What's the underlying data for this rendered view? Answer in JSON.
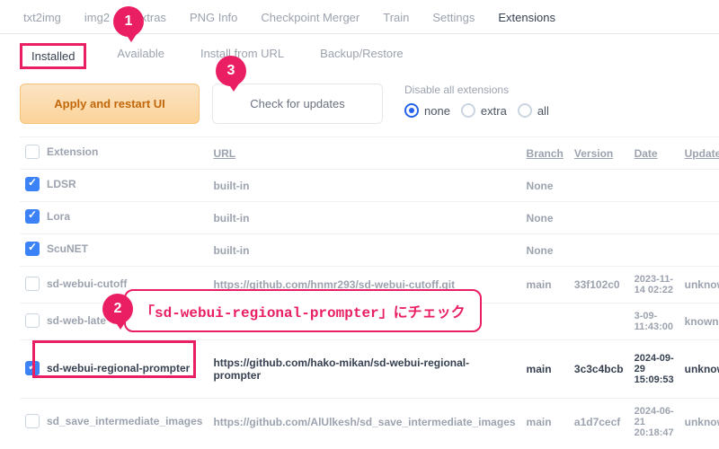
{
  "topTabs": [
    "txt2img",
    "img2",
    "Extras",
    "PNG Info",
    "Checkpoint Merger",
    "Train",
    "Settings",
    "Extensions"
  ],
  "topActive": 7,
  "subTabs": [
    "Installed",
    "Available",
    "Install from URL",
    "Backup/Restore"
  ],
  "subActive": 0,
  "buttons": {
    "apply": "Apply and restart UI",
    "check": "Check for updates"
  },
  "disable": {
    "title": "Disable all extensions",
    "options": [
      "none",
      "extra",
      "all"
    ],
    "selected": 0
  },
  "headers": {
    "ext": "Extension",
    "url": "URL",
    "branch": "Branch",
    "version": "Version",
    "date": "Date",
    "update": "Update"
  },
  "rows": [
    {
      "checked": true,
      "name": "LDSR",
      "url": "built-in",
      "branch": "None",
      "version": "",
      "date": "",
      "update": ""
    },
    {
      "checked": true,
      "name": "Lora",
      "url": "built-in",
      "branch": "None",
      "version": "",
      "date": "",
      "update": ""
    },
    {
      "checked": true,
      "name": "ScuNET",
      "url": "built-in",
      "branch": "None",
      "version": "",
      "date": "",
      "update": ""
    },
    {
      "checked": false,
      "name": "sd-webui-cutoff",
      "url": "https://github.com/hnmr293/sd-webui-cutoff.git",
      "branch": "main",
      "version": "33f102c0",
      "date": "2023-11-14 02:22",
      "update": "unknown"
    },
    {
      "checked": false,
      "name": "sd-web-late",
      "url": "",
      "branch": "",
      "version": "",
      "date": "3-09-11:43:00",
      "update": "known"
    },
    {
      "checked": true,
      "name": "sd-webui-regional-prompter",
      "url": "https://github.com/hako-mikan/sd-webui-regional-prompter",
      "branch": "main",
      "version": "3c3c4bcb",
      "date": "2024-09-29 15:09:53",
      "update": "unknown",
      "highlight": true
    },
    {
      "checked": false,
      "name": "sd_save_intermediate_images",
      "url": "https://github.com/AlUlkesh/sd_save_intermediate_images",
      "branch": "main",
      "version": "a1d7cecf",
      "date": "2024-06-21 20:18:47",
      "update": "unknown"
    }
  ],
  "badges": {
    "b1": "1",
    "b2": "2",
    "b3": "3"
  },
  "speech": "「sd-webui-regional-prompter」にチェック"
}
